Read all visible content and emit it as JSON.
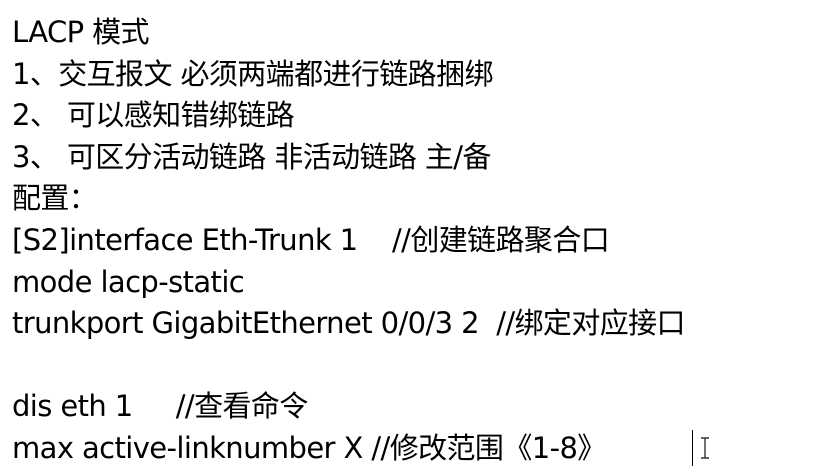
{
  "document": {
    "lines": [
      "LACP 模式",
      "1、交互报文 必须两端都进行链路捆绑",
      "2、 可以感知错绑链路",
      "3、 可区分活动链路 非活动链路 主/备",
      "配置：",
      "[S2]interface Eth-Trunk 1    //创建链路聚合口",
      "mode lacp-static",
      "trunkport GigabitEthernet 0/0/3 2  //绑定对应接口",
      "",
      "dis eth 1     //查看命令",
      "max active-linknumber X //修改范围《1-8》"
    ]
  },
  "cursor": {
    "icon": "text-cursor-icon"
  }
}
